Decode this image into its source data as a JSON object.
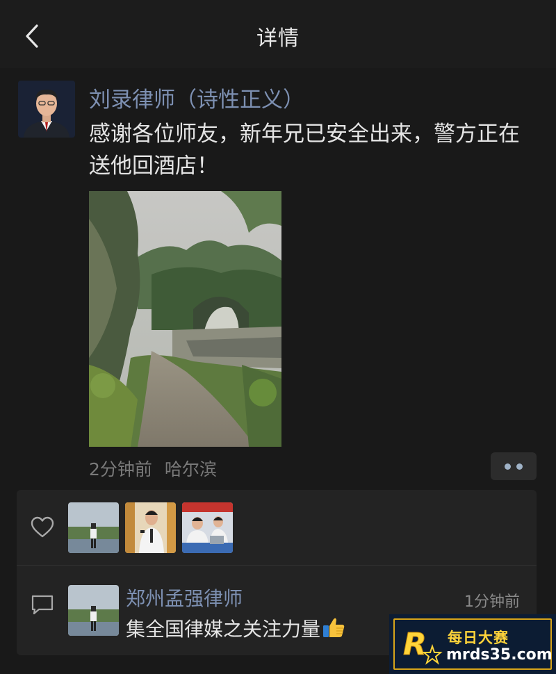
{
  "header": {
    "title": "详情",
    "back_icon": "chevron-left-icon"
  },
  "post": {
    "author": "刘录律师（诗性正义）",
    "text": "感谢各位师友，新年兄已安全出来，警方正在送他回酒店！",
    "time": "2分钟前",
    "location": "哈尔滨",
    "more_icon": "more-dots-icon"
  },
  "likes": {
    "icon": "heart-icon",
    "count_avatars": 3
  },
  "comments": [
    {
      "author": "郑州孟强律师",
      "time": "1分钟前",
      "text": "集全国律媒之关注力量",
      "emoji": "thumbs-up-icon"
    }
  ],
  "watermark": {
    "name": "每日大赛",
    "url": "mrds35.com"
  },
  "colors": {
    "background": "#191919",
    "name_link": "#7d90b2",
    "text": "#e4e4e4",
    "secondary": "#7a7a7a",
    "watermark_gold": "#ffd43a"
  }
}
